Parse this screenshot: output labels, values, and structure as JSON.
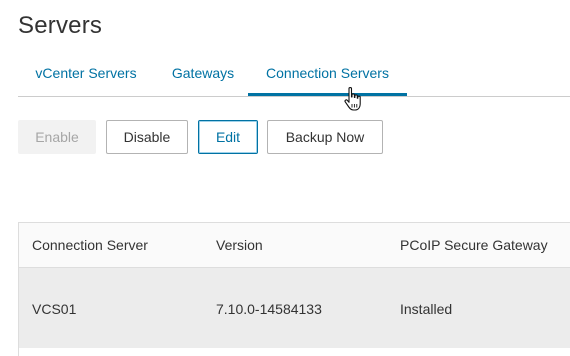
{
  "page": {
    "title": "Servers"
  },
  "tabs": [
    {
      "label": "vCenter Servers",
      "active": false
    },
    {
      "label": "Gateways",
      "active": false
    },
    {
      "label": "Connection Servers",
      "active": true
    }
  ],
  "toolbar": {
    "enable_label": "Enable",
    "disable_label": "Disable",
    "edit_label": "Edit",
    "backup_label": "Backup Now"
  },
  "table": {
    "columns": [
      "Connection Server",
      "Version",
      "PCoIP Secure Gateway"
    ],
    "rows": [
      [
        "VCS01",
        "7.10.0-14584133",
        "Installed"
      ]
    ]
  },
  "icons": {
    "cursor": "hand-pointer-icon"
  },
  "colors": {
    "accent": "#0072a3",
    "selected_row": "#ececec",
    "disabled_button": "#f2f2f2"
  }
}
